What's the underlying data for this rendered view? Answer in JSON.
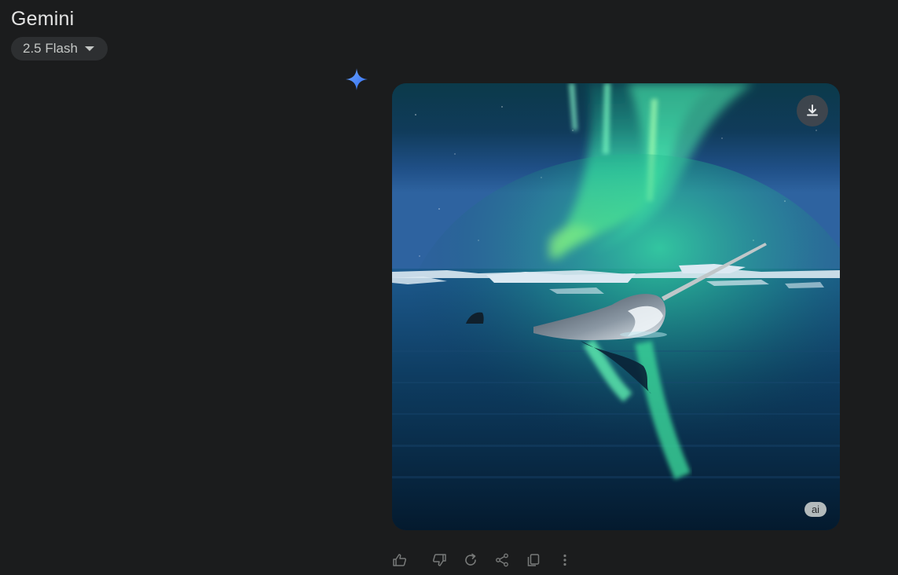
{
  "header": {
    "app_title": "Gemini",
    "model_switcher": {
      "label": "2.5 Flash",
      "caret_icon": "triangle-down-icon"
    }
  },
  "response": {
    "avatar_icon": "gemini-sparkle-icon",
    "generated_image": {
      "subject": "narwhal-under-aurora",
      "download_icon": "download-icon",
      "badge": "ai"
    },
    "actions": [
      {
        "name": "thumbs-up-button",
        "icon": "thumbs-up-icon"
      },
      {
        "name": "thumbs-down-button",
        "icon": "thumbs-down-icon"
      },
      {
        "name": "regenerate-button",
        "icon": "redo-icon"
      },
      {
        "name": "share-button",
        "icon": "share-icon"
      },
      {
        "name": "copy-button",
        "icon": "copy-icon"
      },
      {
        "name": "more-options-button",
        "icon": "more-vertical-icon"
      }
    ]
  },
  "colors": {
    "background": "#1b1c1d",
    "chip": "#2d2f31",
    "accent_blue": "#4a86f5",
    "aurora_green": "#3cf0a0"
  }
}
